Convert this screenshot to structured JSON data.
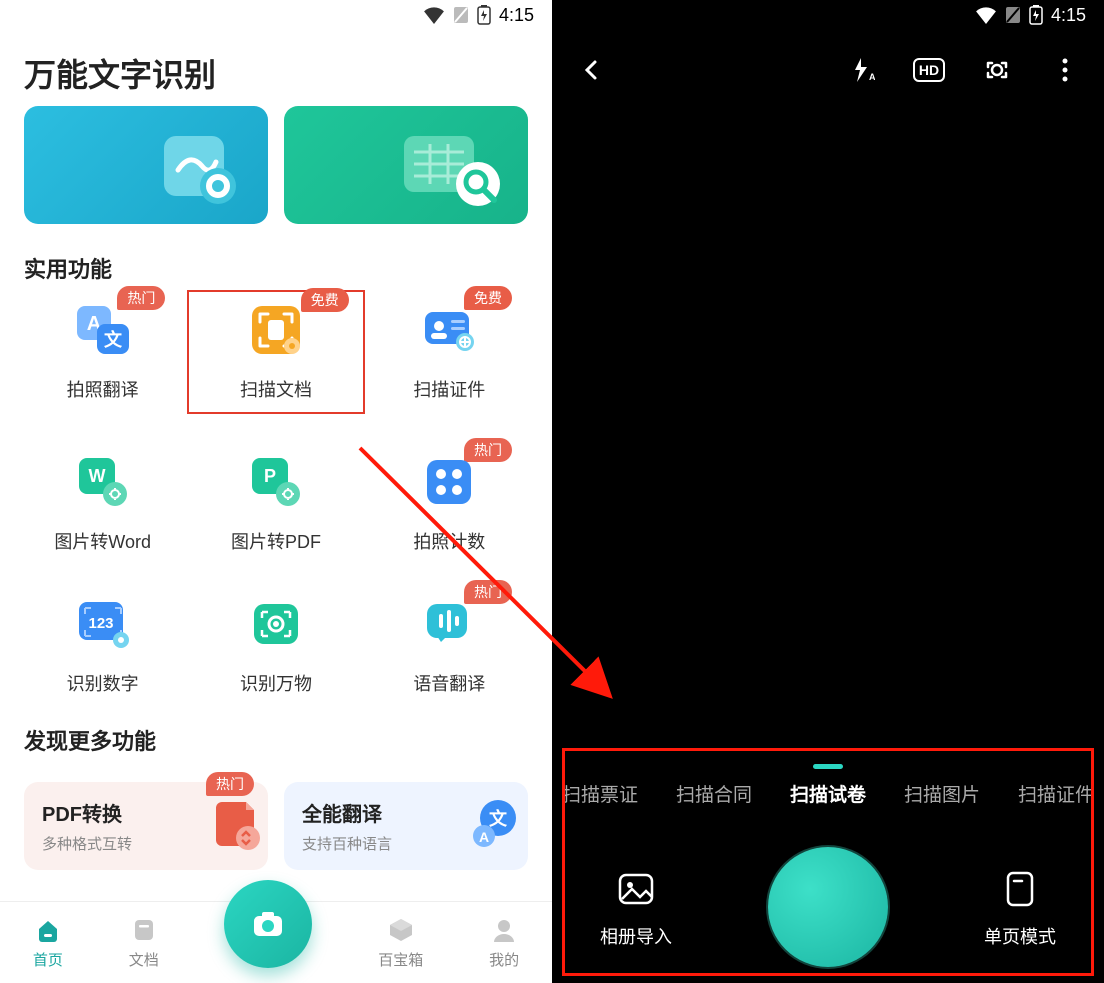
{
  "status": {
    "time": "4:15"
  },
  "left": {
    "app_title": "万能文字识别",
    "section_practical": "实用功能",
    "section_discover": "发现更多功能",
    "badges": {
      "hot": "热门",
      "free": "免费"
    },
    "tiles": [
      {
        "label": "拍照翻译",
        "badge": "hot"
      },
      {
        "label": "扫描文档",
        "badge": "free",
        "highlight": true
      },
      {
        "label": "扫描证件",
        "badge": "free"
      },
      {
        "label": "图片转Word"
      },
      {
        "label": "图片转PDF"
      },
      {
        "label": "拍照计数",
        "badge": "hot"
      },
      {
        "label": "识别数字"
      },
      {
        "label": "识别万物"
      },
      {
        "label": "语音翻译",
        "badge": "hot"
      }
    ],
    "discover": [
      {
        "title": "PDF转换",
        "sub": "多种格式互转",
        "badge": "hot"
      },
      {
        "title": "全能翻译",
        "sub": "支持百种语言"
      }
    ],
    "nav": {
      "home": "首页",
      "docs": "文档",
      "toolbox": "百宝箱",
      "mine": "我的"
    }
  },
  "right": {
    "scan_tabs": [
      "扫描票证",
      "扫描合同",
      "扫描试卷",
      "扫描图片",
      "扫描证件"
    ],
    "active_tab_index": 2,
    "controls": {
      "gallery": "相册导入",
      "mode": "单页模式",
      "hd": "HD"
    }
  },
  "colors": {
    "accent": "#1bb5a2",
    "highlight_red": "#e33b2b"
  }
}
